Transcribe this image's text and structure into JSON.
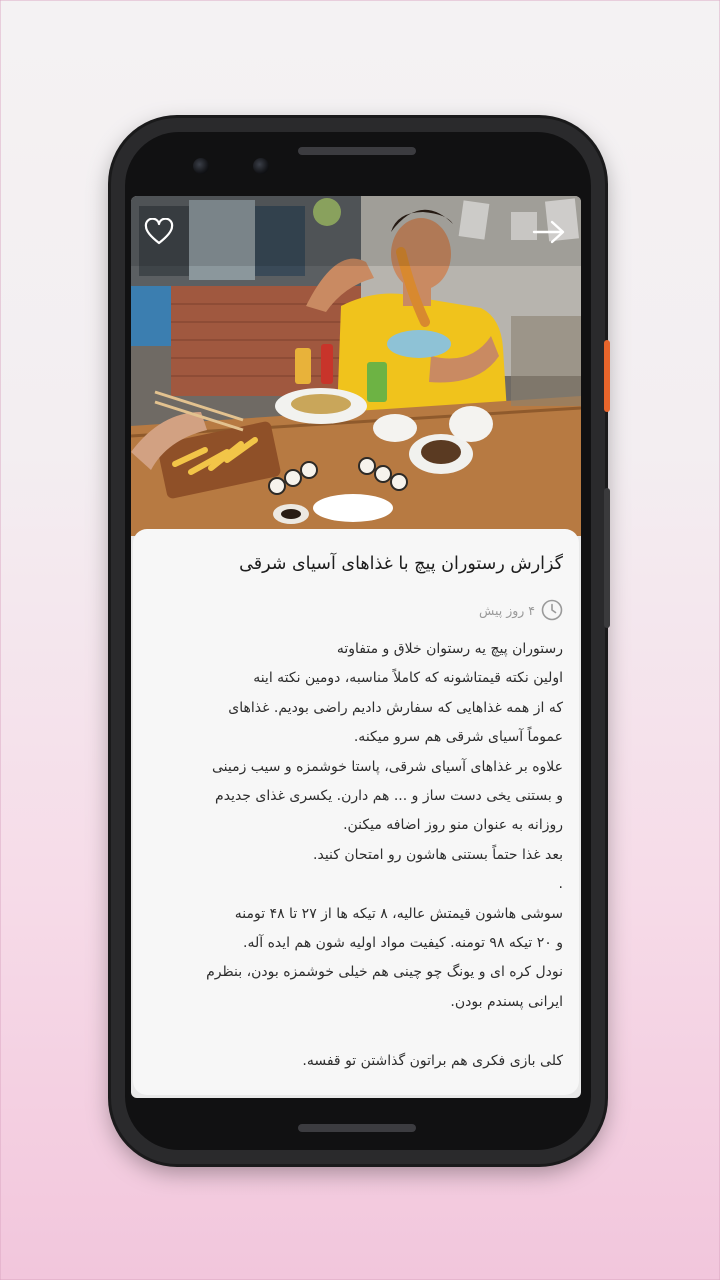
{
  "article": {
    "title": "گزارش رستوران پیچ با غذاهای آسیای شرقی",
    "time_ago": "۴ روز پیش",
    "lines": [
      "رستوران پیچ یه رستوان خلاق و متفاوته",
      "اولین نکته قیمتاشونه که کاملاً مناسبه، دومین نکته اینه",
      "که از همه غذاهایی که سفارش دادیم راضی بودیم. غذاهای",
      "عموماً آسیای شرقی هم سرو میکنه.",
      "علاوه بر غذاهای آسیای شرقی، پاستا خوشمزه و سیب زمینی",
      "و بستنی یخی دست ساز و ... هم دارن. یکسری غذای جدیدم",
      "روزانه به عنوان منو روز اضافه میکنن.",
      "بعد غذا حتماً بستنی هاشون رو امتحان کنید.",
      ".",
      "سوشی هاشون قیمتش عالیه، ۸ تیکه ها از ۲۷ تا ۴۸ تومنه",
      "و ۲۰ تیکه ۹۸ تومنه. کیفیت مواد اولیه شون هم ایده آله.",
      "نودل کره ای و یونگ چو چینی هم خیلی خوشمزه بودن، بنظرم",
      "ایرانی پسندم بودن.",
      "",
      "کلی بازی فکری هم براتون گذاشتن تو قفسه."
    ]
  },
  "icons": {
    "favorite": "heart-outline-icon",
    "back": "arrow-right-icon",
    "time": "clock-icon"
  },
  "colors": {
    "accent_side_button": "#e8652b",
    "card_bg": "#f7f7f7",
    "title_text": "#1d1d1d",
    "meta_text": "#9a9a9a"
  }
}
